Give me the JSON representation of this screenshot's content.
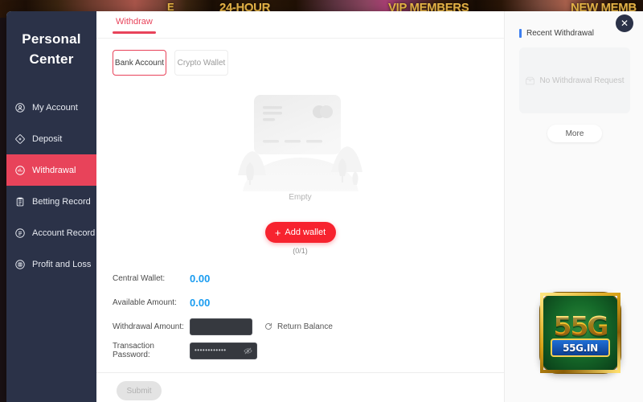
{
  "background": {
    "banner_words": [
      "E",
      "24-HOUR",
      "VIP MEMBERS",
      "NEW MEMB"
    ]
  },
  "sidebar": {
    "title_line1": "Personal",
    "title_line2": "Center",
    "items": [
      {
        "label": "My Account",
        "icon": "user-circle-icon",
        "active": false
      },
      {
        "label": "Deposit",
        "icon": "diamond-icon",
        "active": false
      },
      {
        "label": "Withdrawal",
        "icon": "withdraw-icon",
        "active": true
      },
      {
        "label": "Betting Record",
        "icon": "clipboard-icon",
        "active": false
      },
      {
        "label": "Account Record",
        "icon": "list-circle-icon",
        "active": false
      },
      {
        "label": "Profit and Loss",
        "icon": "chart-circle-icon",
        "active": false
      }
    ]
  },
  "main": {
    "tab_label": "Withdraw",
    "methods": [
      {
        "label": "Bank Account",
        "selected": true
      },
      {
        "label": "Crypto Wallet",
        "selected": false
      }
    ],
    "empty_label": "Empty",
    "add_wallet_label": "Add wallet",
    "add_wallet_plus": "+",
    "wallet_count": "(0/1)",
    "fields": {
      "central_wallet_label": "Central Wallet:",
      "central_wallet_value": "0.00",
      "available_amount_label": "Available Amount:",
      "available_amount_value": "0.00",
      "withdrawal_amount_label": "Withdrawal Amount:",
      "withdrawal_amount_value": "",
      "withdrawal_amount_placeholder": "",
      "return_balance_label": "Return Balance",
      "transaction_password_label": "Transaction Password:",
      "transaction_password_value": "••••••••••••",
      "transaction_password_placeholder": ""
    },
    "submit_label": "Submit"
  },
  "right_panel": {
    "title": "Recent Withdrawal",
    "empty_text": "No Withdrawal Request",
    "more_label": "More",
    "logo_text": "55G",
    "logo_ribbon": "55G.IN"
  },
  "close_label": "✕",
  "colors": {
    "sidebar_bg": "#2b3248",
    "accent_red": "#e8435a",
    "add_button_red": "#f7232f",
    "value_blue": "#1a9cf0",
    "panel_bg": "#fafafa",
    "title_bar_blue": "#3c7ef0"
  }
}
